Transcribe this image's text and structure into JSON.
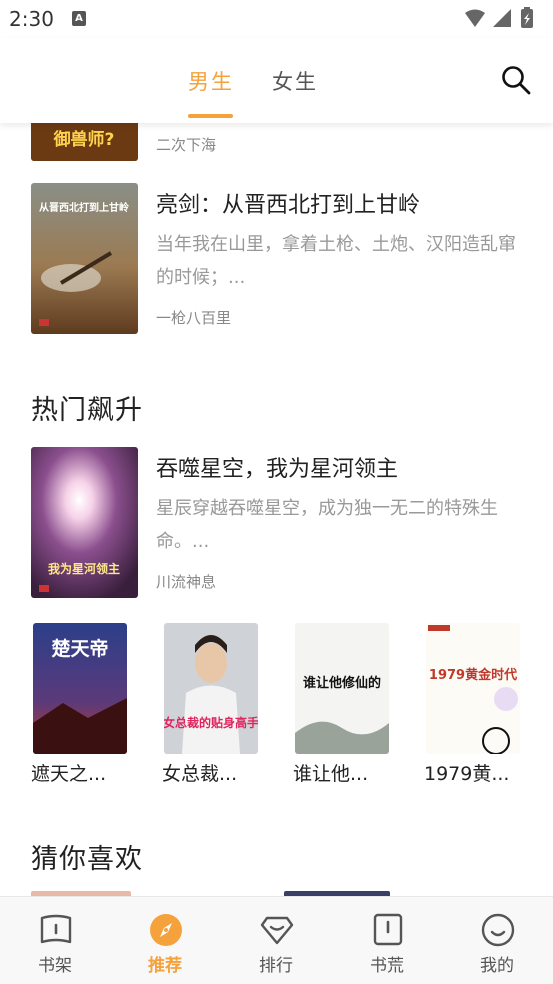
{
  "status_bar": {
    "time": "2:30",
    "notif_letter": "A"
  },
  "tabs": [
    {
      "label": "男生",
      "active": true
    },
    {
      "label": "女生",
      "active": false
    }
  ],
  "accent_color": "#f5a13c",
  "books": [
    {
      "title": "",
      "description": "",
      "author": "二次下海",
      "cover_text": "御兽师?"
    },
    {
      "title": "亮剑：从晋西北打到上甘岭",
      "description": "当年我在山里，拿着土枪、土炮、汉阳造乱窜的时候；...",
      "author": "一枪八百里",
      "cover_text": "从晋西北打到上甘岭"
    }
  ],
  "sections": {
    "hot_rising": "热门飙升",
    "guess_you_like": "猜你喜欢"
  },
  "featured": {
    "title": "吞噬星空，我为星河领主",
    "description": "星辰穿越吞噬星空，成为独一无二的特殊生命。...",
    "author": "川流神息",
    "cover_text": "我为星河领主"
  },
  "mini_books": [
    {
      "label": "遮天之...",
      "cover_text": "楚天帝"
    },
    {
      "label": "女总裁...",
      "cover_text": "女总裁的贴身高手"
    },
    {
      "label": "谁让他...",
      "cover_text": "谁让他修仙的"
    },
    {
      "label": "1979黄...",
      "cover_text": "1979黄金时代"
    }
  ],
  "bottom_nav": [
    {
      "label": "书架",
      "icon": "bookshelf-icon",
      "active": false
    },
    {
      "label": "推荐",
      "icon": "compass-icon",
      "active": true
    },
    {
      "label": "排行",
      "icon": "ranking-icon",
      "active": false
    },
    {
      "label": "书荒",
      "icon": "book-shortage-icon",
      "active": false
    },
    {
      "label": "我的",
      "icon": "profile-icon",
      "active": false
    }
  ]
}
